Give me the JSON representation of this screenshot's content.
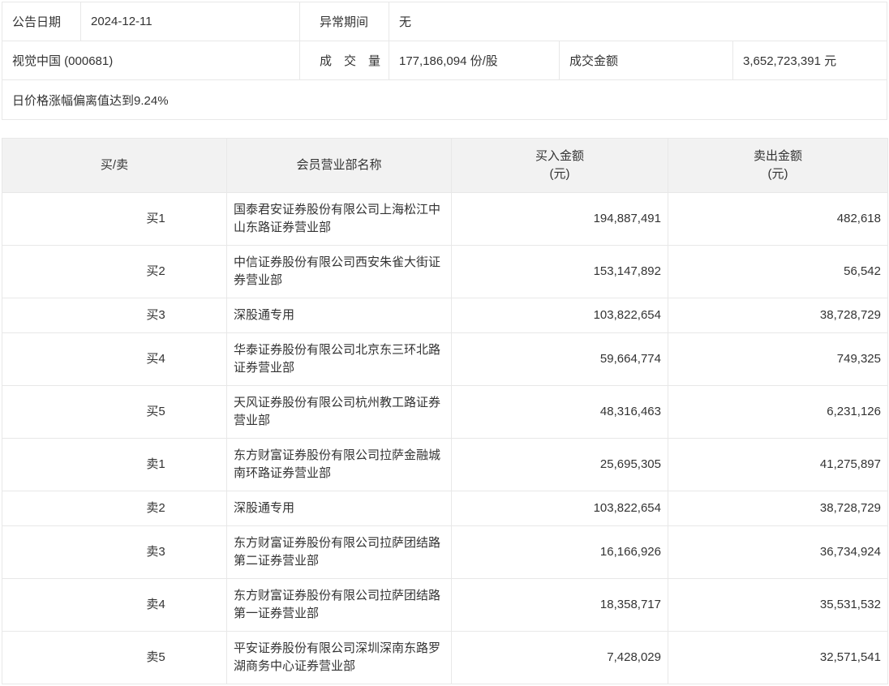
{
  "colors": {
    "border": "#e8e8e8",
    "header_bg": "#f2f2f2",
    "text": "#333333"
  },
  "info_panel": {
    "announce_date_label": "公告日期",
    "announce_date_value": "2024-12-11",
    "abnormal_period_label": "异常期间",
    "abnormal_period_value": "无",
    "stock_name": "视觉中国 (000681)",
    "volume_label": "成　交　量",
    "volume_value": "177,186,094 份/股",
    "turnover_label": "成交金额",
    "turnover_value": "3,652,723,391 元",
    "note": "日价格涨幅偏离值达到9.24%"
  },
  "table": {
    "headers": {
      "side": "买/卖",
      "branch": "会员营业部名称",
      "buy": "买入金额",
      "sell": "卖出金额",
      "unit": "(元)"
    },
    "rows": [
      {
        "side": "买1",
        "branch": "国泰君安证券股份有限公司上海松江中山东路证券营业部",
        "buy": "194,887,491",
        "sell": "482,618"
      },
      {
        "side": "买2",
        "branch": "中信证券股份有限公司西安朱雀大街证券营业部",
        "buy": "153,147,892",
        "sell": "56,542"
      },
      {
        "side": "买3",
        "branch": "深股通专用",
        "buy": "103,822,654",
        "sell": "38,728,729"
      },
      {
        "side": "买4",
        "branch": "华泰证券股份有限公司北京东三环北路证券营业部",
        "buy": "59,664,774",
        "sell": "749,325"
      },
      {
        "side": "买5",
        "branch": "天风证券股份有限公司杭州教工路证券营业部",
        "buy": "48,316,463",
        "sell": "6,231,126"
      },
      {
        "side": "卖1",
        "branch": "东方财富证券股份有限公司拉萨金融城南环路证券营业部",
        "buy": "25,695,305",
        "sell": "41,275,897"
      },
      {
        "side": "卖2",
        "branch": "深股通专用",
        "buy": "103,822,654",
        "sell": "38,728,729"
      },
      {
        "side": "卖3",
        "branch": "东方财富证券股份有限公司拉萨团结路第二证券营业部",
        "buy": "16,166,926",
        "sell": "36,734,924"
      },
      {
        "side": "卖4",
        "branch": "东方财富证券股份有限公司拉萨团结路第一证券营业部",
        "buy": "18,358,717",
        "sell": "35,531,532"
      },
      {
        "side": "卖5",
        "branch": "平安证券股份有限公司深圳深南东路罗湖商务中心证券营业部",
        "buy": "7,428,029",
        "sell": "32,571,541"
      }
    ]
  }
}
